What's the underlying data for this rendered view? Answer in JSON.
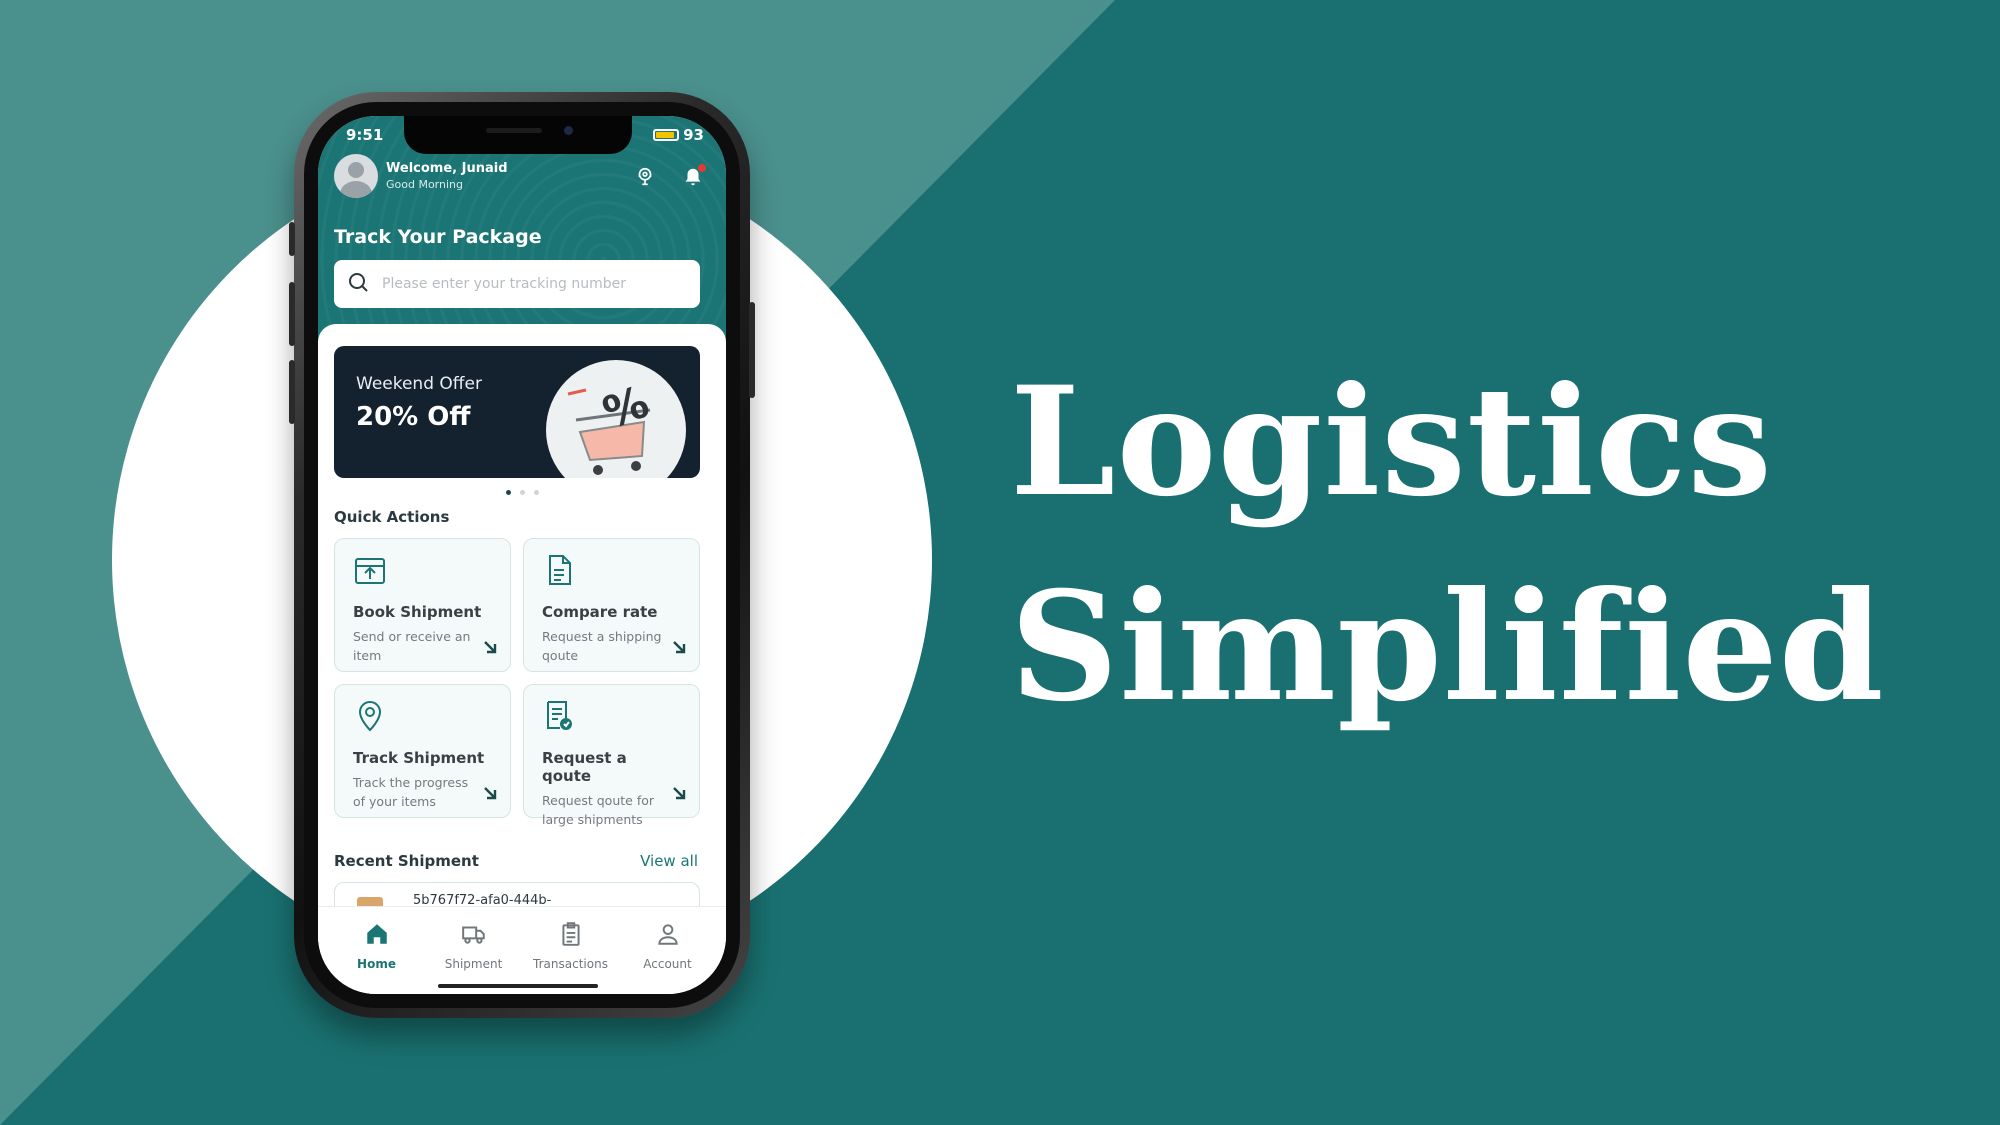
{
  "colors": {
    "brand_teal": "#1a7070",
    "light_band": "#4a908c",
    "circle": "#ffffff",
    "text_white": "#ffffff",
    "accent_teal": "#1b7575",
    "notification_dot": "#e53935"
  },
  "headline": {
    "line1": "Logistics",
    "line2": "Simplified"
  },
  "phone": {
    "status_bar": {
      "time": "9:51",
      "battery": "93"
    },
    "header": {
      "welcome": "Welcome, Junaid",
      "greeting": "Good Morning",
      "icons": [
        "support-icon",
        "bell-icon"
      ]
    },
    "track": {
      "title": "Track Your Package",
      "search_placeholder": "Please enter your tracking number"
    },
    "offer": {
      "label": "Weekend Offer",
      "headline": "20% Off",
      "carousel_count": 3,
      "carousel_active": 1
    },
    "quick_actions": {
      "title": "Quick Actions",
      "items": [
        {
          "name": "Book Shipment",
          "description": "Send or receive an item",
          "icon": "box-upload-icon"
        },
        {
          "name": "Compare rate",
          "description": "Request a shipping qoute",
          "icon": "document-icon"
        },
        {
          "name": "Track Shipment",
          "description": "Track the progress of your items",
          "icon": "location-pin-icon"
        },
        {
          "name": "Request a qoute",
          "description": "Request qoute for large shipments",
          "icon": "quote-document-icon"
        }
      ]
    },
    "recent": {
      "title": "Recent Shipment",
      "view_all": "View all",
      "first_id": "5b767f72-afa0-444b-"
    },
    "tabs": [
      {
        "label": "Home",
        "icon": "home-icon",
        "active": true
      },
      {
        "label": "Shipment",
        "icon": "truck-icon",
        "active": false
      },
      {
        "label": "Transactions",
        "icon": "clipboard-icon",
        "active": false
      },
      {
        "label": "Account",
        "icon": "user-icon",
        "active": false
      }
    ]
  }
}
